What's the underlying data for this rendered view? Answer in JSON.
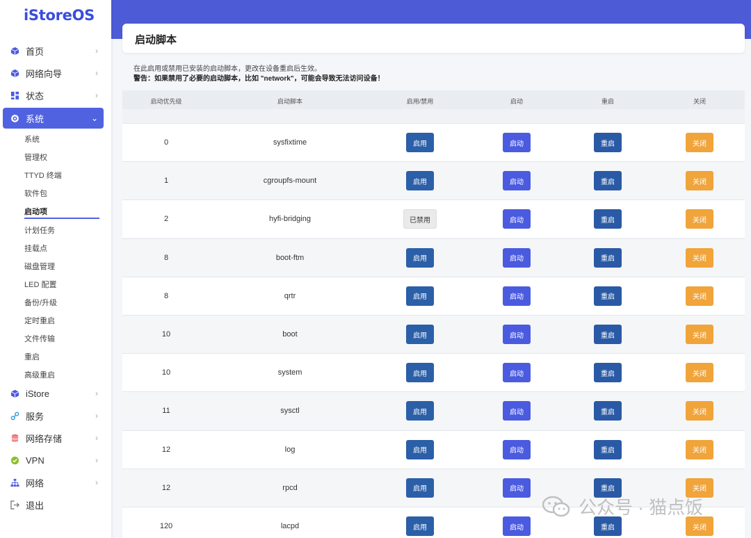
{
  "app": {
    "logo": "iStoreOS"
  },
  "page": {
    "title": "启动脚本",
    "description": "在此启用或禁用已安装的启动脚本，更改在设备重启后生效。",
    "warning": "警告：如果禁用了必要的启动脚本，比如 \"network\"，可能会导致无法访问设备！"
  },
  "sidebar": {
    "items": [
      {
        "label": "首页",
        "icon": "cube-icon"
      },
      {
        "label": "网络向导",
        "icon": "cube-icon"
      },
      {
        "label": "状态",
        "icon": "dashboard-icon"
      },
      {
        "label": "系统",
        "icon": "gear-icon"
      },
      {
        "label": "iStore",
        "icon": "cube-icon"
      },
      {
        "label": "服务",
        "icon": "link-icon"
      },
      {
        "label": "网络存储",
        "icon": "database-icon"
      },
      {
        "label": "VPN",
        "icon": "vpn-icon"
      },
      {
        "label": "网络",
        "icon": "network-icon"
      },
      {
        "label": "退出",
        "icon": "logout-icon"
      }
    ],
    "sub_items": [
      "系统",
      "管理权",
      "TTYD 终端",
      "软件包",
      "启动项",
      "计划任务",
      "挂载点",
      "磁盘管理",
      "LED 配置",
      "备份/升级",
      "定时重启",
      "文件传输",
      "重启",
      "高级重启"
    ],
    "active_sub": "启动项"
  },
  "table": {
    "headers": [
      "启动优先级",
      "启动脚本",
      "启用/禁用",
      "启动",
      "重启",
      "关闭"
    ],
    "rows": [
      {
        "priority": "0",
        "name": "sysfixtime",
        "enable": "启用",
        "state": "enabled"
      },
      {
        "priority": "1",
        "name": "cgroupfs-mount",
        "enable": "启用",
        "state": "enabled"
      },
      {
        "priority": "2",
        "name": "hyfi-bridging",
        "enable": "已禁用",
        "state": "disabled"
      },
      {
        "priority": "8",
        "name": "boot-ftm",
        "enable": "启用",
        "state": "enabled"
      },
      {
        "priority": "8",
        "name": "qrtr",
        "enable": "启用",
        "state": "enabled"
      },
      {
        "priority": "10",
        "name": "boot",
        "enable": "启用",
        "state": "enabled"
      },
      {
        "priority": "10",
        "name": "system",
        "enable": "启用",
        "state": "enabled"
      },
      {
        "priority": "11",
        "name": "sysctl",
        "enable": "启用",
        "state": "enabled"
      },
      {
        "priority": "12",
        "name": "log",
        "enable": "启用",
        "state": "enabled"
      },
      {
        "priority": "12",
        "name": "rpcd",
        "enable": "启用",
        "state": "enabled"
      },
      {
        "priority": "120",
        "name": "lacpd",
        "enable": "启用",
        "state": "enabled"
      }
    ],
    "labels": {
      "start": "启动",
      "restart": "重启",
      "stop": "关闭"
    }
  },
  "watermark": {
    "text": "公众号 · 猫点饭"
  },
  "colors": {
    "accent": "#4d5bd6",
    "enable": "#2b5fa8",
    "start": "#4b5be0",
    "restart": "#2a5aa6",
    "stop": "#f0a43a"
  }
}
